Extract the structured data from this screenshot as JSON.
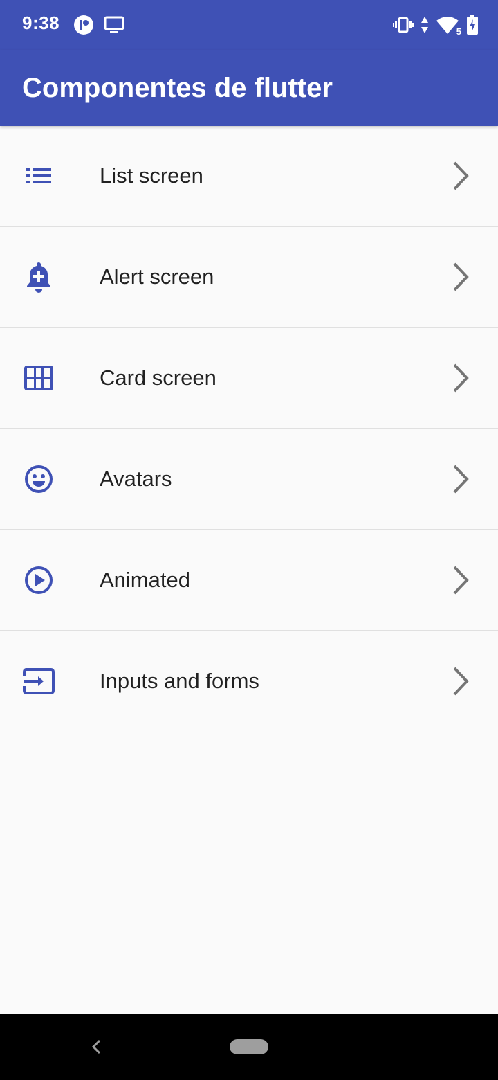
{
  "status_bar": {
    "time": "9:38",
    "left_icons": [
      "app-notification-icon",
      "cast-screen-icon"
    ],
    "right_icons": [
      "vibrate-icon",
      "data-arrows-icon",
      "wifi-icon",
      "battery-charging-icon"
    ],
    "wifi_badge": "5"
  },
  "app_bar": {
    "title": "Componentes de flutter",
    "background": "#3f51b5"
  },
  "list": {
    "items": [
      {
        "label": "List screen",
        "icon": "list-icon"
      },
      {
        "label": "Alert screen",
        "icon": "add-alert-icon"
      },
      {
        "label": "Card screen",
        "icon": "grid-icon"
      },
      {
        "label": "Avatars",
        "icon": "smiley-face-icon"
      },
      {
        "label": "Animated",
        "icon": "play-circle-icon"
      },
      {
        "label": "Inputs and forms",
        "icon": "input-icon"
      }
    ],
    "icon_color": "#3f51b5",
    "chevron_color": "#757575",
    "divider_color": "#e0e0e0"
  },
  "nav_bar": {
    "buttons": [
      "back-icon",
      "home-pill"
    ]
  }
}
